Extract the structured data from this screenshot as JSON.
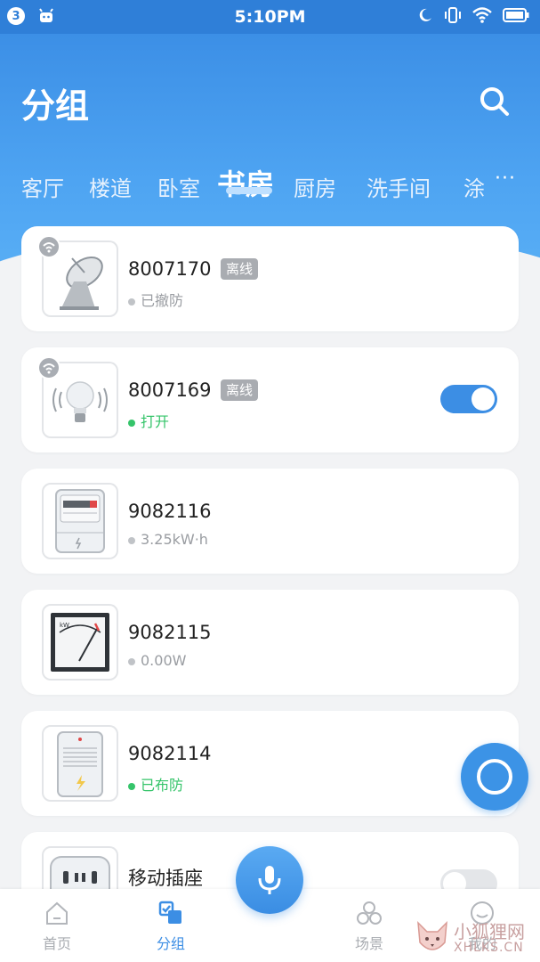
{
  "status_bar": {
    "notification_count": "3",
    "time": "5:10PM"
  },
  "header": {
    "title": "分组"
  },
  "tabs": [
    {
      "label": "客厅"
    },
    {
      "label": "楼道"
    },
    {
      "label": "卧室"
    },
    {
      "label": "书房",
      "active": true
    },
    {
      "label": "厨房"
    },
    {
      "label": "洗手间"
    },
    {
      "label": "涂"
    }
  ],
  "tab_more": "···",
  "devices": [
    {
      "name": "8007170",
      "tag": "离线",
      "status": "已撤防",
      "icon": "satellite-dish-icon"
    },
    {
      "name": "8007169",
      "tag": "离线",
      "status": "打开",
      "icon": "light-bulb-icon",
      "toggle": "on"
    },
    {
      "name": "9082116",
      "status": "3.25kW·h",
      "icon": "electric-meter-icon"
    },
    {
      "name": "9082115",
      "status": "0.00W",
      "icon": "power-gauge-icon"
    },
    {
      "name": "9082114",
      "status": "已布防",
      "icon": "alarm-sensor-icon"
    },
    {
      "name": "移动插座",
      "icon": "power-socket-icon",
      "toggle": "off"
    }
  ],
  "bottom_nav": [
    {
      "label": "首页",
      "icon": "home-icon"
    },
    {
      "label": "分组",
      "icon": "group-icon",
      "active": true
    },
    {
      "label": "场景",
      "icon": "scene-icon"
    },
    {
      "label": "我的",
      "icon": "profile-icon"
    }
  ],
  "watermark": {
    "text": "小狐狸网",
    "sub": "XHLKS.CN"
  },
  "colors": {
    "primary": "#3c8ee4",
    "online_green": "#35c46a",
    "offline_tag": "#a9acb1"
  }
}
